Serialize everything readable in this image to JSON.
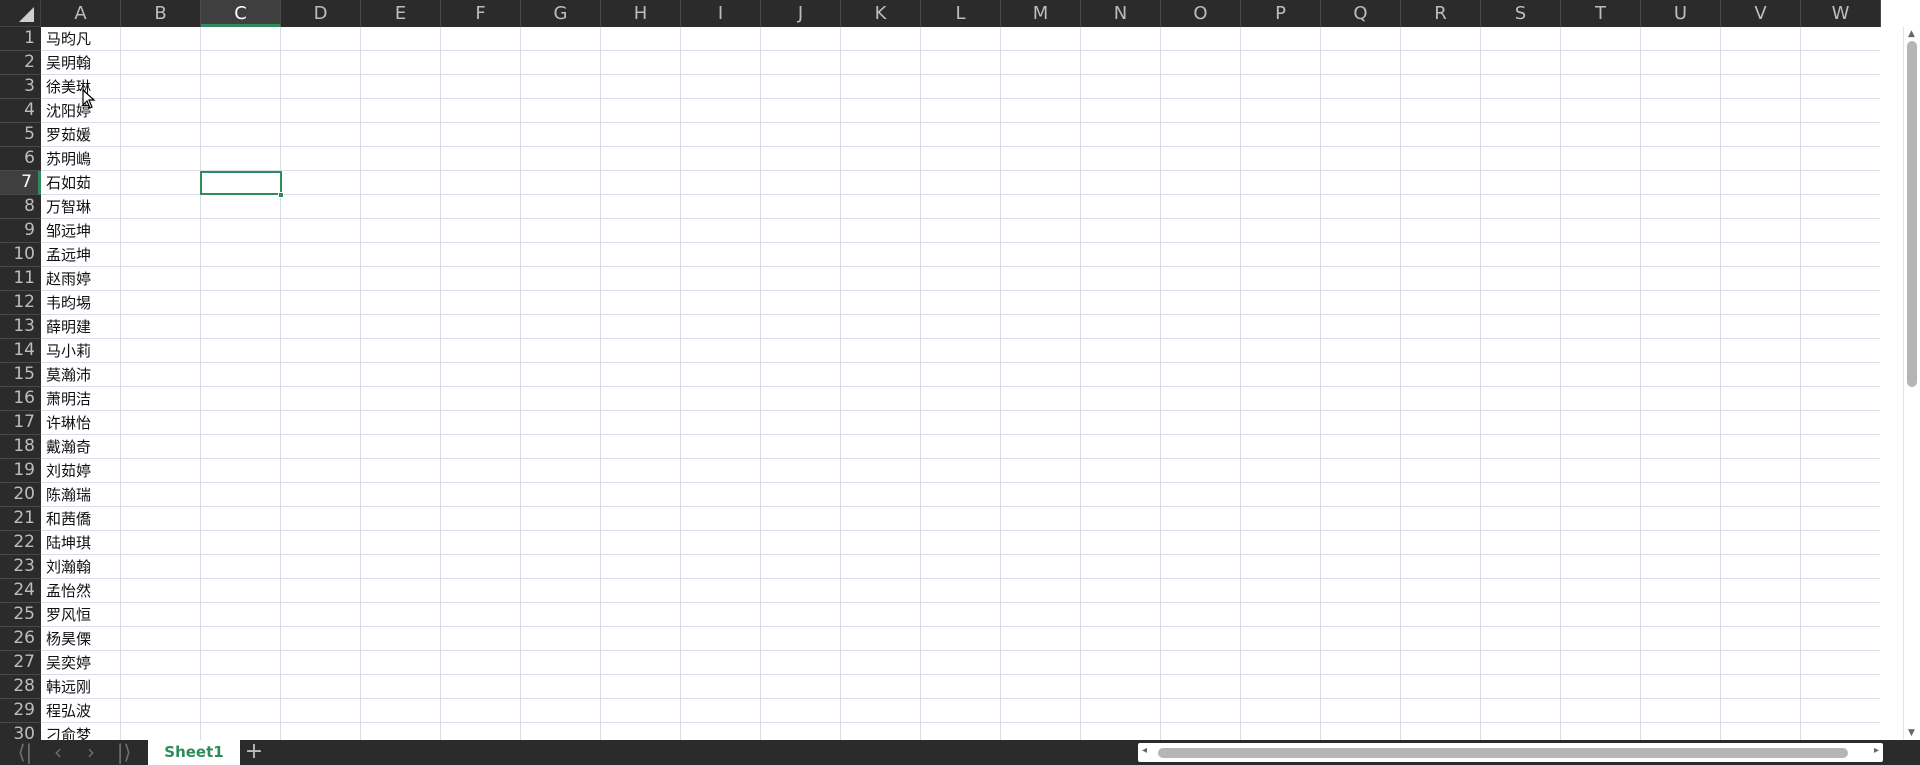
{
  "columns": [
    "A",
    "B",
    "C",
    "D",
    "E",
    "F",
    "G",
    "H",
    "I",
    "J",
    "K",
    "L",
    "M",
    "N",
    "O",
    "P",
    "Q",
    "R",
    "S",
    "T",
    "U",
    "V",
    "W"
  ],
  "active_column": "C",
  "rows": [
    "1",
    "2",
    "3",
    "4",
    "5",
    "6",
    "7",
    "8",
    "9",
    "10",
    "11",
    "12",
    "13",
    "14",
    "15",
    "16",
    "17",
    "18",
    "19",
    "20",
    "21",
    "22",
    "23",
    "24",
    "25",
    "26",
    "27",
    "28",
    "29",
    "30"
  ],
  "active_row": "7",
  "column_a_values": [
    "马昀凡",
    "吴明翰",
    "徐美琳",
    "沈阳婷",
    "罗茹媛",
    "苏明嶋",
    "石如茹",
    "万智琳",
    "邹远坤",
    "孟远坤",
    "赵雨婷",
    "韦昀埸",
    "薛明建",
    "马小莉",
    "莫瀚沛",
    "萧明洁",
    "许琳怡",
    "戴瀚奇",
    "刘茹婷",
    "陈瀚瑞",
    "和茜僑",
    "陆坤琪",
    "刘瀚翰",
    "孟怡然",
    "罗风恒",
    "杨昊傈",
    "吴奕婷",
    "韩远刚",
    "程弘波",
    "刁俞梦"
  ],
  "sheet_tabs": [
    "Sheet1"
  ],
  "active_sheet": "Sheet1",
  "icons": {
    "nav_first": "⟨|",
    "nav_prev": "‹",
    "nav_next": "›",
    "nav_last": "|⟩",
    "add_sheet": "+"
  },
  "colors": {
    "accent": "#2f8a5c",
    "header_bg": "#2b2b2b",
    "gridline": "#d9dce9"
  }
}
